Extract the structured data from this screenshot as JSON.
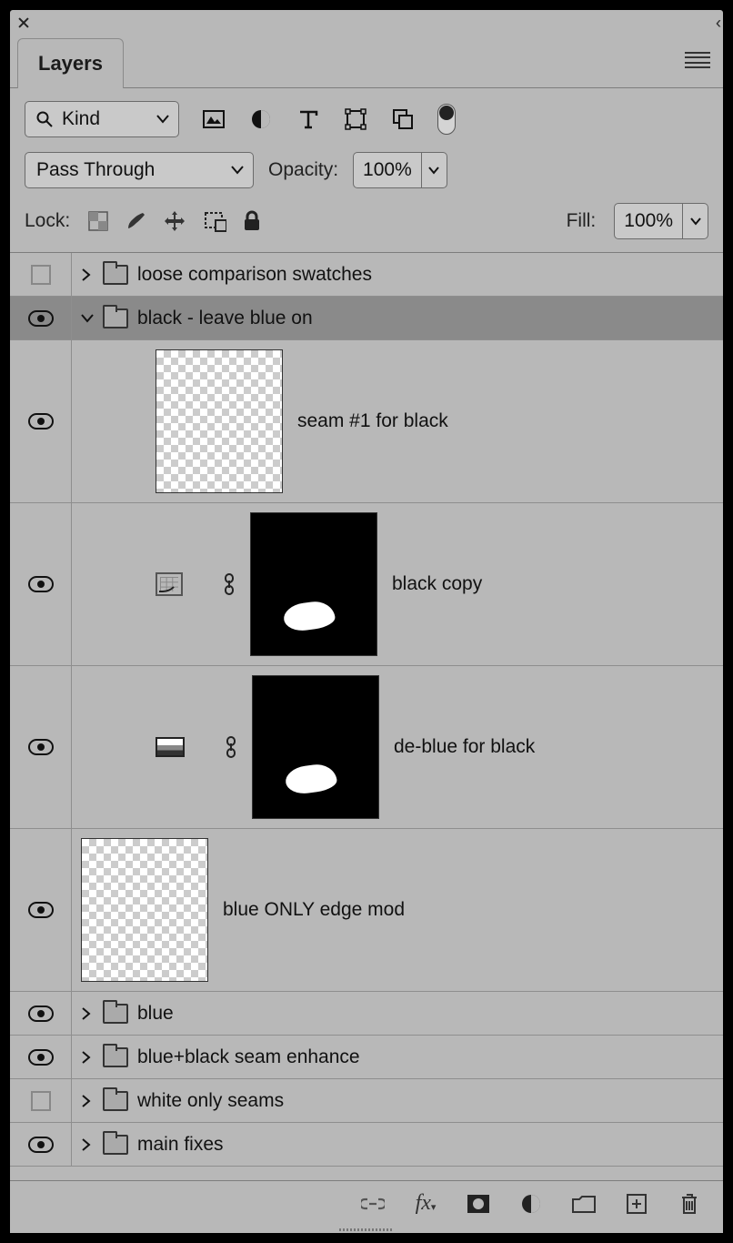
{
  "panel": {
    "tab_label": "Layers"
  },
  "filter": {
    "kind_label": "Kind"
  },
  "blend": {
    "mode": "Pass Through"
  },
  "opacity": {
    "label": "Opacity:",
    "value": "100%"
  },
  "lock": {
    "label": "Lock:"
  },
  "fill": {
    "label": "Fill:",
    "value": "100%"
  },
  "layers": [
    {
      "id": "loose",
      "name": "loose comparison swatches",
      "visible": false,
      "type": "group",
      "expanded": false,
      "indent": 1
    },
    {
      "id": "blackgrp",
      "name": "black - leave blue on",
      "visible": true,
      "type": "group",
      "expanded": true,
      "indent": 1,
      "selected": true
    },
    {
      "id": "seam1",
      "name": "seam #1 for black",
      "visible": true,
      "type": "layer",
      "thumb": "trans-large",
      "indent": 2
    },
    {
      "id": "bcopy",
      "name": "black copy",
      "visible": true,
      "type": "adjustment",
      "adj": "curves",
      "thumb": "mask",
      "indent": 2
    },
    {
      "id": "deblue",
      "name": "de-blue for black",
      "visible": true,
      "type": "adjustment",
      "adj": "gradmap",
      "thumb": "mask",
      "indent": 2
    },
    {
      "id": "blueedge",
      "name": "blue ONLY edge mod",
      "visible": true,
      "type": "layer",
      "thumb": "trans-large",
      "indent": 1,
      "noDisclosure": true
    },
    {
      "id": "blue",
      "name": "blue",
      "visible": true,
      "type": "group",
      "expanded": false,
      "indent": 1
    },
    {
      "id": "bbseam",
      "name": "blue+black seam enhance",
      "visible": true,
      "type": "group",
      "expanded": false,
      "indent": 1
    },
    {
      "id": "white",
      "name": "white only seams",
      "visible": false,
      "type": "group",
      "expanded": false,
      "indent": 1
    },
    {
      "id": "mainfix",
      "name": "main fixes",
      "visible": true,
      "type": "group",
      "expanded": false,
      "indent": 1
    }
  ]
}
